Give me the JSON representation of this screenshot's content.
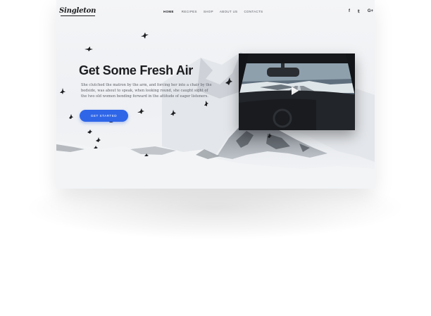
{
  "brand": {
    "logo_text": "Singleton"
  },
  "nav": {
    "items": [
      {
        "label": "HOME",
        "active": true
      },
      {
        "label": "RECIPES",
        "active": false
      },
      {
        "label": "SHOP",
        "active": false
      },
      {
        "label": "ABOUT US",
        "active": false
      },
      {
        "label": "CONTACTS",
        "active": false
      }
    ],
    "social": [
      {
        "icon": "facebook-icon",
        "glyph": "f"
      },
      {
        "icon": "twitter-icon",
        "glyph": "𝕥"
      },
      {
        "icon": "google-plus-icon",
        "glyph": "G+"
      }
    ]
  },
  "hero": {
    "title": "Get Some Fresh Air",
    "text": "She clutched the matron by the arm, and forcing her into a chair by the bedside, was about to speak, when looking round, she caught sight of the two old women bending forward in the attitude of eager listeners.",
    "cta_label": "GET STARTED"
  },
  "video": {
    "icon": "play-icon",
    "accent": "#2f66e8"
  },
  "colors": {
    "accent": "#2f66e8",
    "text_dark": "#1c1d20"
  }
}
